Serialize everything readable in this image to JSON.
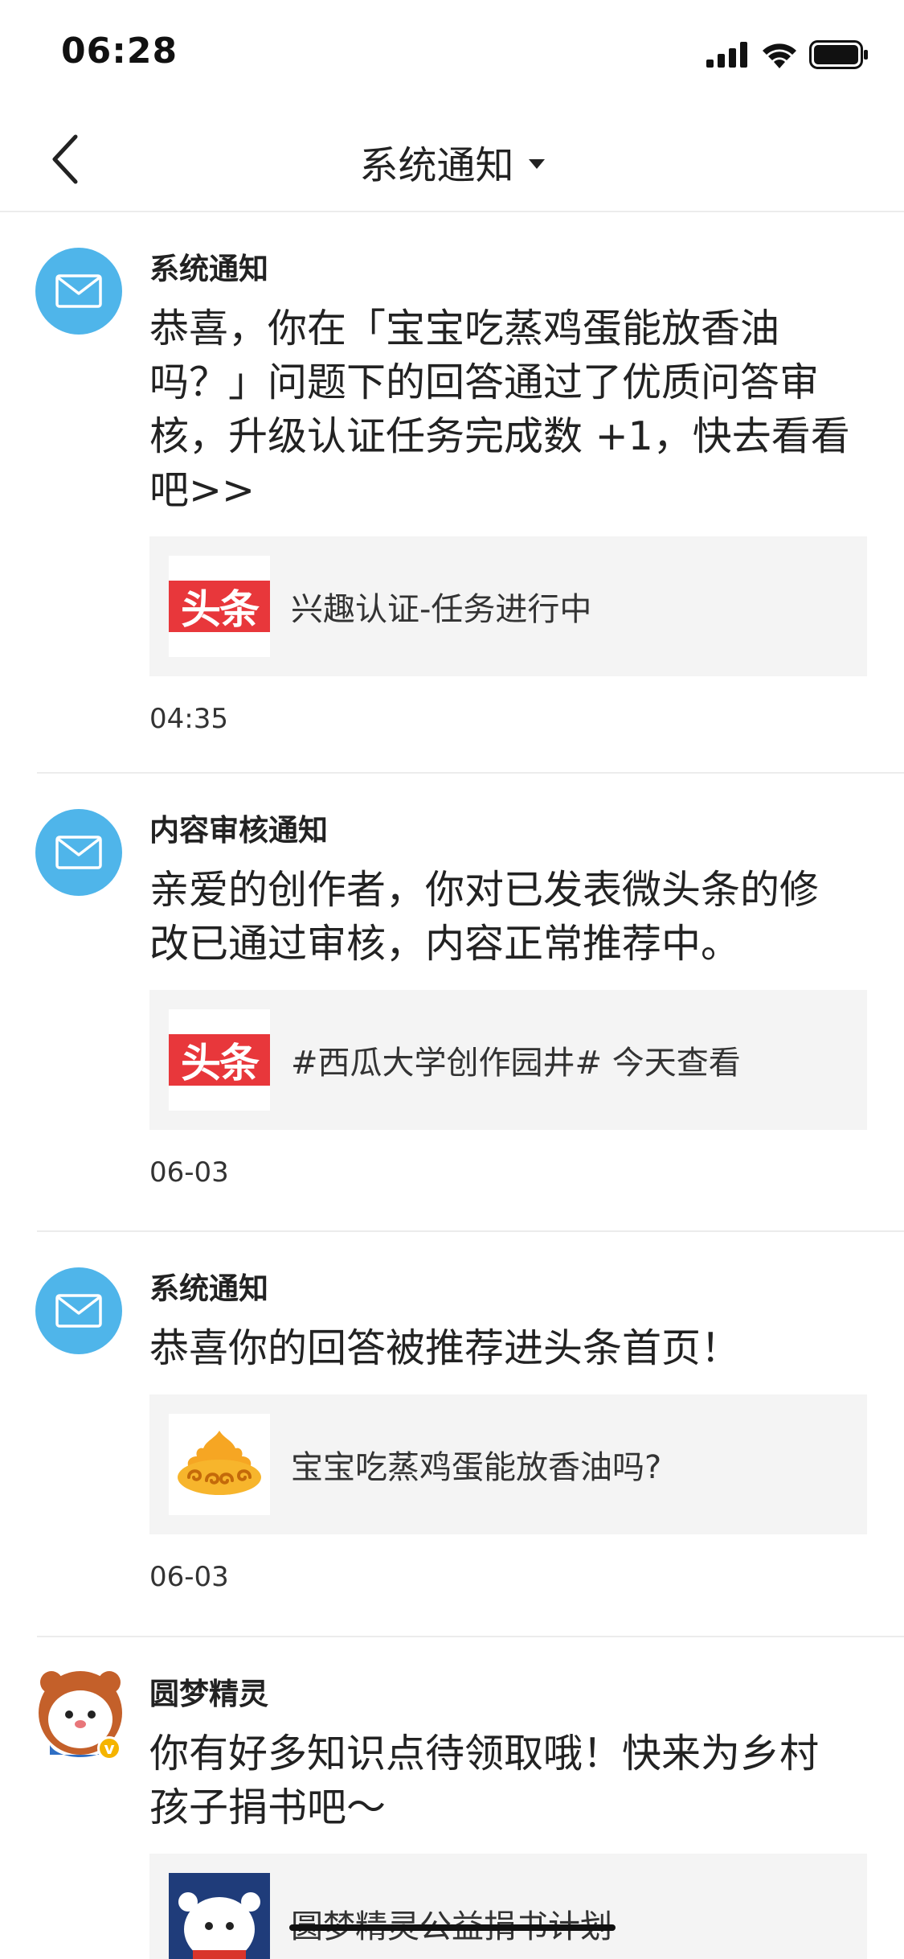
{
  "status_bar": {
    "time": "06:28",
    "icons": [
      "cellular-signal-icon",
      "wifi-icon",
      "battery-icon"
    ]
  },
  "nav": {
    "back_icon": "chevron-left-icon",
    "title": "系统通知",
    "dropdown_icon": "caret-down-icon"
  },
  "colors": {
    "mail_avatar_bg": "#4fb5ea",
    "toutiao_red": "#e8373b",
    "card_bg": "#f4f4f4",
    "divider": "#ececec"
  },
  "notifications": [
    {
      "sender": "系统通知",
      "avatar": "mail-icon",
      "lines": [
        "恭喜，你在「宝宝吃蒸鸡蛋能放香油",
        "吗？」问题下的回答通过了优质问答审",
        "核，升级认证任务完成数 +1，快去看看",
        "吧>>"
      ],
      "card": {
        "thumb_logo": "头条",
        "text": "兴趣认证-任务进行中"
      },
      "time": "04:35"
    },
    {
      "sender": "内容审核通知",
      "avatar": "mail-icon",
      "lines": [
        "亲爱的创作者，你对已发表微头条的修",
        "改已通过审核，内容正常推荐中。"
      ],
      "card": {
        "thumb_logo": "头条",
        "text": "#西瓜大学创作园井# 今天查看"
      },
      "time": "06-03"
    },
    {
      "sender": "系统通知",
      "avatar": "mail-icon",
      "lines": [
        "恭喜你的回答被推荐进头条首页！"
      ],
      "card": {
        "thumb_icon": "golden-cloud-icon",
        "text": "宝宝吃蒸鸡蛋能放香油吗?"
      },
      "time": "06-03"
    },
    {
      "sender": "圆梦精灵",
      "avatar": "cartoon-bear-avatar",
      "verified_icon": "verified-v-badge-icon",
      "lines": [
        "你有好多知识点待领取哦！快来为乡村",
        "孩子捐书吧～"
      ],
      "card": {
        "thumb_icon": "cartoon-mascot-icon",
        "text": "圆梦精灵公益捐书计划"
      }
    }
  ]
}
